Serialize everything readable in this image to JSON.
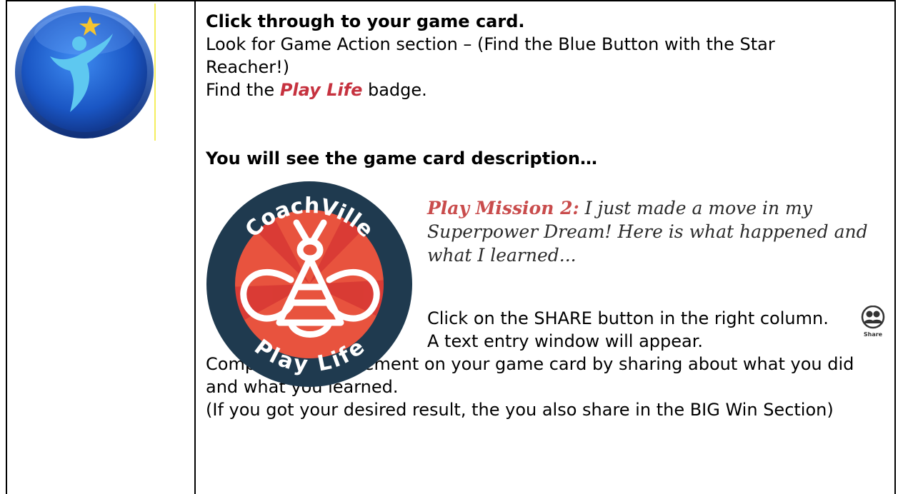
{
  "main": {
    "line1": "Click through to your game card.",
    "line2": "Look for Game Action section – (Find the Blue Button with the Star",
    "line3": "Reacher!)",
    "line4_prefix": "Find the ",
    "line4_badge": "Play Life",
    "line4_suffix": " badge.",
    "heading2": "You will see the game card description…",
    "share_instruction": "Click on the SHARE button in the right column.",
    "text_entry": "A text entry window will appear.",
    "complete_line1": "Complete this statement on your game card by sharing about what you did",
    "complete_line2": "and what you learned.",
    "big_win": "(If you got your desired result, the you also share in the BIG Win Section)"
  },
  "mission": {
    "label": "Play Mission 2",
    "colon": ":",
    "text1": " I just made a move in my",
    "text2": "Superpower Dream!  Here is what happened and",
    "text3": "what I learned..."
  },
  "badge": {
    "top_text": "CoachVille",
    "bottom_text": "Play Life"
  },
  "share_icon": {
    "label": "Share",
    "icon": "people-icon"
  },
  "colors": {
    "accent_red": "#c6323f",
    "mission_red": "#c94c4c",
    "badge_navy": "#1f3a4f",
    "badge_orange": "#e8533e",
    "logo_blue": "#1a56c4"
  }
}
